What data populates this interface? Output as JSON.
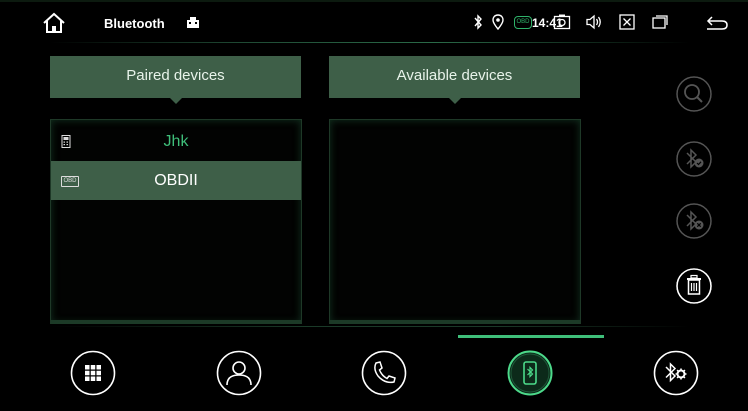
{
  "status_bar": {
    "title": "Bluetooth",
    "obd_badge": "OBD",
    "time": "14:41",
    "icons": [
      "home-icon",
      "usb-icon",
      "bluetooth-icon",
      "location-icon",
      "camera-icon",
      "volume-icon",
      "close-box-icon",
      "window-icon",
      "back-icon"
    ]
  },
  "paired_panel": {
    "header": "Paired devices",
    "devices": [
      {
        "name": "Jhk",
        "icon": "phone-icon",
        "selected": false
      },
      {
        "name": "OBDII",
        "icon": "obd-icon",
        "icon_label": "OBD",
        "selected": true
      }
    ]
  },
  "available_panel": {
    "header": "Available devices",
    "devices": []
  },
  "actions": [
    "search-icon",
    "bluetooth-connect-icon",
    "bluetooth-disconnect-icon",
    "trash-icon"
  ],
  "bottom_nav": {
    "items": [
      "keypad-icon",
      "contacts-icon",
      "phone-icon",
      "bluetooth-phone-icon",
      "bluetooth-settings-icon"
    ],
    "active_index": 3
  },
  "colors": {
    "accent": "#3fbf7a",
    "header_bg": "#3e5f48",
    "background": "#000000"
  }
}
